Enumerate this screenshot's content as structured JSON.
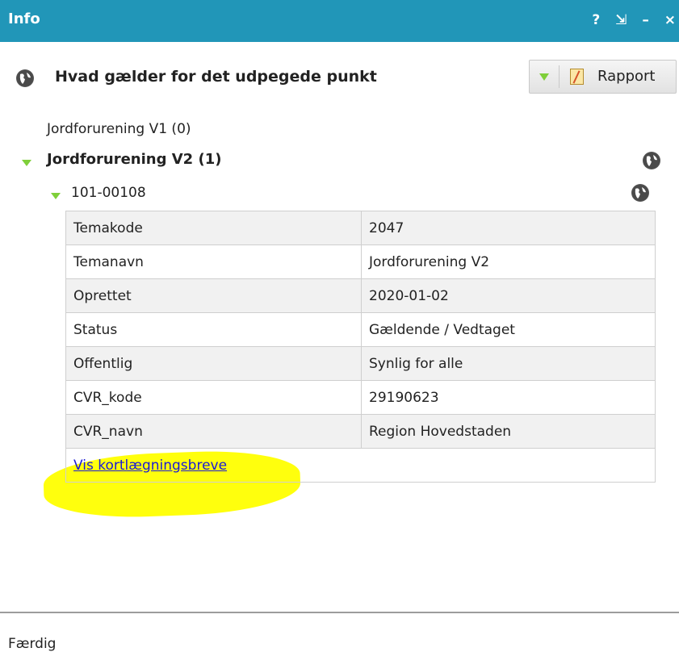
{
  "window": {
    "title": "Info",
    "controls": [
      "?",
      "⇲",
      "–",
      "×"
    ]
  },
  "header": {
    "heading": "Hvad gælder for det udpegede punkt",
    "rapport_label": "Rapport"
  },
  "tree": {
    "layer1": "Jordforurening V1 (0)",
    "layer2": "Jordforurening V2 (1)",
    "feature": "101-00108"
  },
  "attributes": [
    {
      "key": "Temakode",
      "value": "2047"
    },
    {
      "key": "Temanavn",
      "value": "Jordforurening V2"
    },
    {
      "key": "Oprettet",
      "value": "2020-01-02"
    },
    {
      "key": "Status",
      "value": "Gældende / Vedtaget"
    },
    {
      "key": "Offentlig",
      "value": "Synlig for alle"
    },
    {
      "key": "CVR_kode",
      "value": "29190623"
    },
    {
      "key": "CVR_navn",
      "value": "Region Hovedstaden"
    }
  ],
  "link_text": "Vis kortlægningsbreve",
  "status_text": "Færdig",
  "colors": {
    "titlebar": "#2196b8",
    "highlight": "#ffff00",
    "link": "#1a1ad6",
    "expand_triangle": "#7fcf3a"
  },
  "icons": [
    "globe-icon",
    "report-icon",
    "expand-triangle-icon"
  ]
}
